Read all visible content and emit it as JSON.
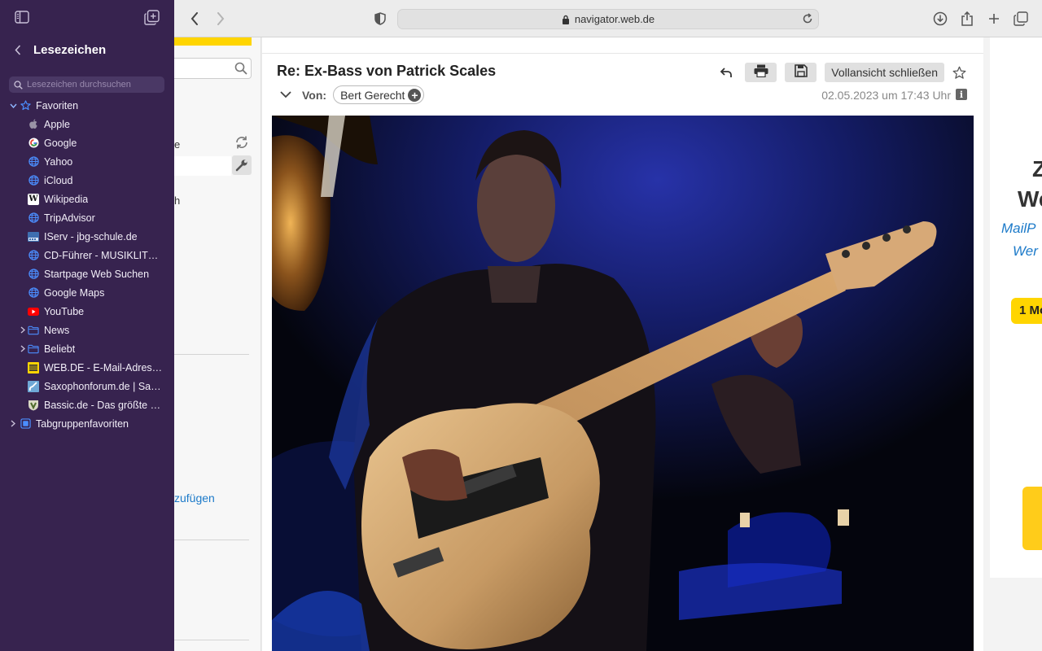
{
  "browser": {
    "url": "navigator.web.de"
  },
  "sidebar": {
    "title": "Lesezeichen",
    "search_placeholder": "Lesezeichen durchsuchen",
    "favorites_label": "Favoriten",
    "items": [
      {
        "label": "Apple",
        "icon": "apple-icon"
      },
      {
        "label": "Google",
        "icon": "google-icon"
      },
      {
        "label": "Yahoo",
        "icon": "globe-icon"
      },
      {
        "label": "iCloud",
        "icon": "globe-icon"
      },
      {
        "label": "Wikipedia",
        "icon": "wikipedia-icon"
      },
      {
        "label": "TripAdvisor",
        "icon": "globe-icon"
      },
      {
        "label": "IServ - jbg-schule.de",
        "icon": "iserv-icon"
      },
      {
        "label": "CD-Führer - MUSIKLITER…",
        "icon": "globe-icon"
      },
      {
        "label": "Startpage Web Suchen",
        "icon": "globe-icon"
      },
      {
        "label": "Google Maps",
        "icon": "globe-icon"
      },
      {
        "label": "YouTube",
        "icon": "youtube-icon"
      },
      {
        "label": "News",
        "icon": "folder-icon"
      },
      {
        "label": "Beliebt",
        "icon": "folder-icon"
      },
      {
        "label": "WEB.DE - E-Mail-Adresse…",
        "icon": "webde-icon"
      },
      {
        "label": "Saxophonforum.de | Saxo…",
        "icon": "saxophonforum-icon"
      },
      {
        "label": "Bassic.de - Das größte de…",
        "icon": "bassic-icon"
      }
    ],
    "tabgroups_label": "Tabgruppenfavoriten"
  },
  "background_app": {
    "fragment_e": "e",
    "fragment_h": "h",
    "fragment_link": "zufügen"
  },
  "mail": {
    "subject": "Re: Ex-Bass von Patrick Scales",
    "from_label": "Von:",
    "sender": "Bert Gerecht",
    "date": "02.05.2023 um 17:43 Uhr",
    "close_full_view": "Vollansicht schließen",
    "info_glyph": "i"
  },
  "ad": {
    "line1": "Z",
    "line2": "We",
    "line3": "MailP",
    "line4": "Wer",
    "button": "1 Mo"
  },
  "colors": {
    "sidebar_bg": "#37234f",
    "accent_blue": "#1c7ac9",
    "brand_yellow": "#ffd500"
  }
}
